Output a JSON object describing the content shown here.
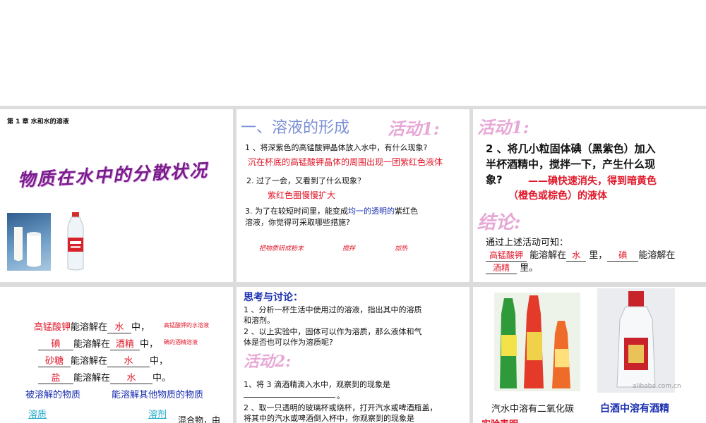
{
  "slide1": {
    "chapter": "第 1 章  水和水的溶液",
    "title": "物质在水中的分散状况",
    "milk_icon": "milk-glass-photo",
    "bottle_icon": "water-bottle-photo"
  },
  "slide2": {
    "heading": "一、溶液的形成",
    "activity": "活动1:",
    "q1": "1 、将深紫色的高锰酸钾晶体放入水中，有什么现象?",
    "a1": "沉在杯底的高锰酸钾晶体的周围出现一团紫红色液体",
    "q2": "2. 过了一会，又看到了什么现象？",
    "a2": "紫红色圈慢慢扩大",
    "q3_pre": "3. 为了在较短时间里，能变成",
    "q3_hl": "均一的透明的",
    "q3_post": "紫红色",
    "q3_line2": "溶液，你觉得可采取哪些措施?",
    "m1": "把物质研成粉末",
    "m2": "搅拌",
    "m3": "加热"
  },
  "slide3": {
    "activity": "活动1:",
    "q_line1": "2 、将几小粒固体碘（黑紫色）加入",
    "q_line2": "半杯酒精中，搅拌一下，产生什么现",
    "q_line3": "象?",
    "answer1": "——碘快速消失，得到暗黄色",
    "answer2": "（橙色或棕色）的液体",
    "conclusion": "结论:",
    "lead": "通过上述活动可知：",
    "b1": "高锰酸钾",
    "t1": "能溶解在",
    "b2": "水",
    "t2": "里，",
    "b3": "碘",
    "t3": "能溶解在",
    "b4": "酒精",
    "t4": "里。"
  },
  "slide4": {
    "r1a": "高锰酸钾",
    "r1b": "能溶解在",
    "r1c": "水",
    "r1d": "中，",
    "r1note": "高锰酸钾的水溶液",
    "r2a": "碘",
    "r2b": "能溶解在",
    "r2c": "酒精",
    "r2d": "中，",
    "r2note": "碘的酒精溶液",
    "r3a": "砂糖",
    "r3b": "能溶解在",
    "r3c": "水",
    "r3d": "中，",
    "r4a": "盐",
    "r4b": "能溶解在",
    "r4c": "水",
    "r4d": "中。",
    "label_left": "被溶解的物质",
    "label_right": "能溶解其他物质的物质",
    "solute": "溶质",
    "solvent": "溶剂",
    "mix": "混合物，由"
  },
  "slide5": {
    "heading": "思考与讨论：",
    "p1a": "1 、分析一杯生活中使用过的溶液，指出其中的溶质",
    "p1b": "和溶剂。",
    "p2a": "2 、以上实验中，固体可以作为溶质，那么液体和气",
    "p2b": "体是否也可以作为溶质呢?",
    "activity": "活动2:",
    "s1": "1、将 3 滴酒精滴入水中，观察到的现象是",
    "s1tail": "。",
    "s2a": "2 、取一只透明的玻璃杯或烧杯，打开汽水或啤酒瓶盖，",
    "s2b": "将其中的汽水或啤酒倒入杯中，你观察到的现象是"
  },
  "slide6": {
    "drinks_icon": "soda-bottles-photo",
    "liquor_icon": "liquor-bottle-photo",
    "watermark": "alibaba.com.cn",
    "cap_left": "汽水中溶有二氧化碳",
    "cap_right": "白酒中溶有酒精",
    "bottom": "实验表明"
  }
}
